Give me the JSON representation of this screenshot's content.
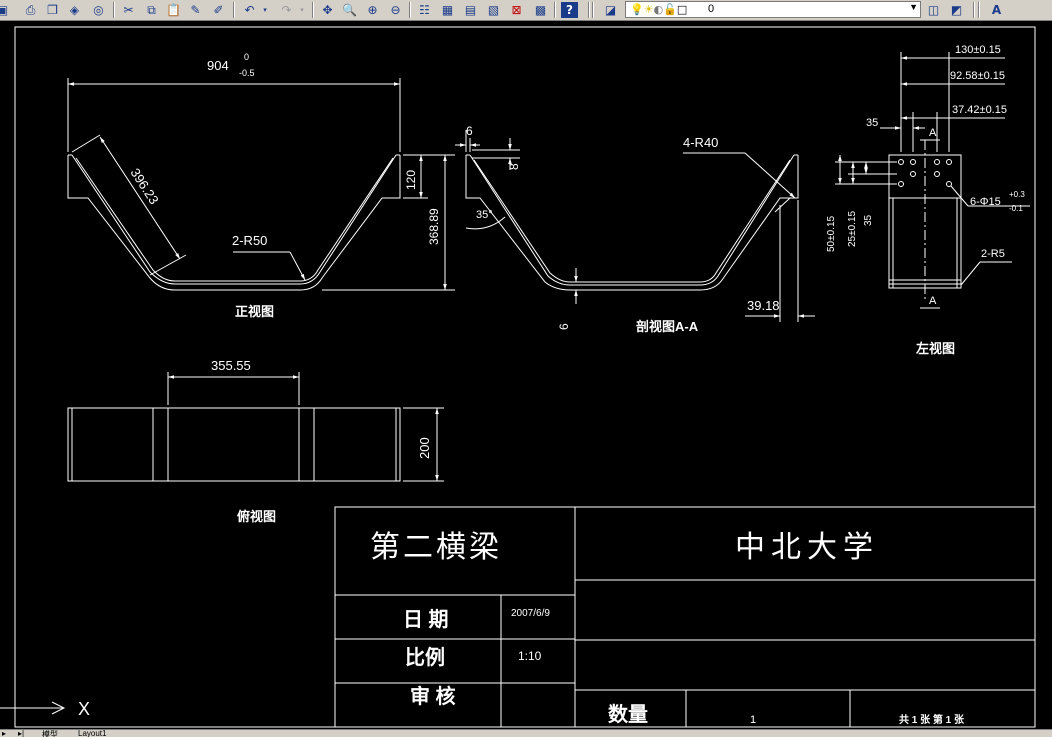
{
  "toolbar": {
    "layer_name": "0"
  },
  "titleblock": {
    "part_name": "第二横梁",
    "school": "中北大学",
    "date_label": "日 期",
    "date_value": "2007/6/9",
    "scale_label": "比例",
    "scale_value": "1:10",
    "review_label": "审 核",
    "quantity_label": "数量",
    "quantity_value": "1",
    "sheet_text": "共 1 张 第 1 张"
  },
  "front_view": {
    "label": "正视图",
    "dim_width": "904",
    "dim_width_tol_upper": "0",
    "dim_width_tol_lower": "-0.5",
    "dim_slant": "396.23",
    "dim_radius": "2-R50",
    "dim_flange": "120",
    "dim_height": "368.89"
  },
  "section_view": {
    "label": "剖视图A-A",
    "dim_thk_top": "6",
    "dim_8": "8",
    "dim_angle": "35°",
    "dim_radius": "4-R40",
    "dim_thk_bottom": "6",
    "dim_offset": "39.18"
  },
  "left_view": {
    "label": "左视图",
    "dim_130": "130±0.15",
    "dim_92": "92.58±0.15",
    "dim_37": "37.42±0.15",
    "dim_35": "35",
    "dim_35b": "35",
    "dim_50": "50±0.15",
    "dim_25": "25±0.15",
    "dim_holes": "6-Φ15",
    "dim_holes_tol_upper": "+0.3",
    "dim_holes_tol_lower": "-0.1",
    "dim_r5": "2-R5",
    "section_mark_top": "A",
    "section_mark_bottom": "A"
  },
  "top_view": {
    "label": "俯视图",
    "dim_width": "355.55",
    "dim_height": "200"
  },
  "ucs_label": "X",
  "tabs": {
    "model": "模型",
    "layout1": "Layout1"
  }
}
